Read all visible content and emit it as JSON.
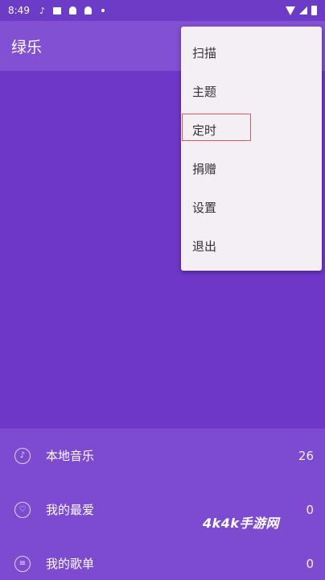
{
  "status_bar": {
    "time": "8:49",
    "icons": [
      "music-note-icon",
      "image-icon",
      "notification-icon",
      "notification-icon",
      "dot-icon"
    ],
    "right_icons": [
      "wifi-icon",
      "signal-icon",
      "battery-icon"
    ]
  },
  "app_bar": {
    "title": "绿乐"
  },
  "menu": {
    "items": [
      {
        "label": "扫描"
      },
      {
        "label": "主题"
      },
      {
        "label": "定时"
      },
      {
        "label": "捐赠"
      },
      {
        "label": "设置"
      },
      {
        "label": "退出"
      }
    ],
    "highlighted_index": 2,
    "highlight_color": "#e05a5a"
  },
  "library": {
    "items": [
      {
        "label": "本地音乐",
        "count": "26",
        "icon": "music-note-icon"
      },
      {
        "label": "我的最爱",
        "count": "0",
        "icon": "heart-icon"
      },
      {
        "label": "我的歌单",
        "count": "0",
        "icon": "list-icon"
      }
    ]
  },
  "watermark": "4k4k手游网",
  "colors": {
    "background": "#7a45cf",
    "header": "#6f37c8",
    "menu_background": "#f4eef5"
  }
}
